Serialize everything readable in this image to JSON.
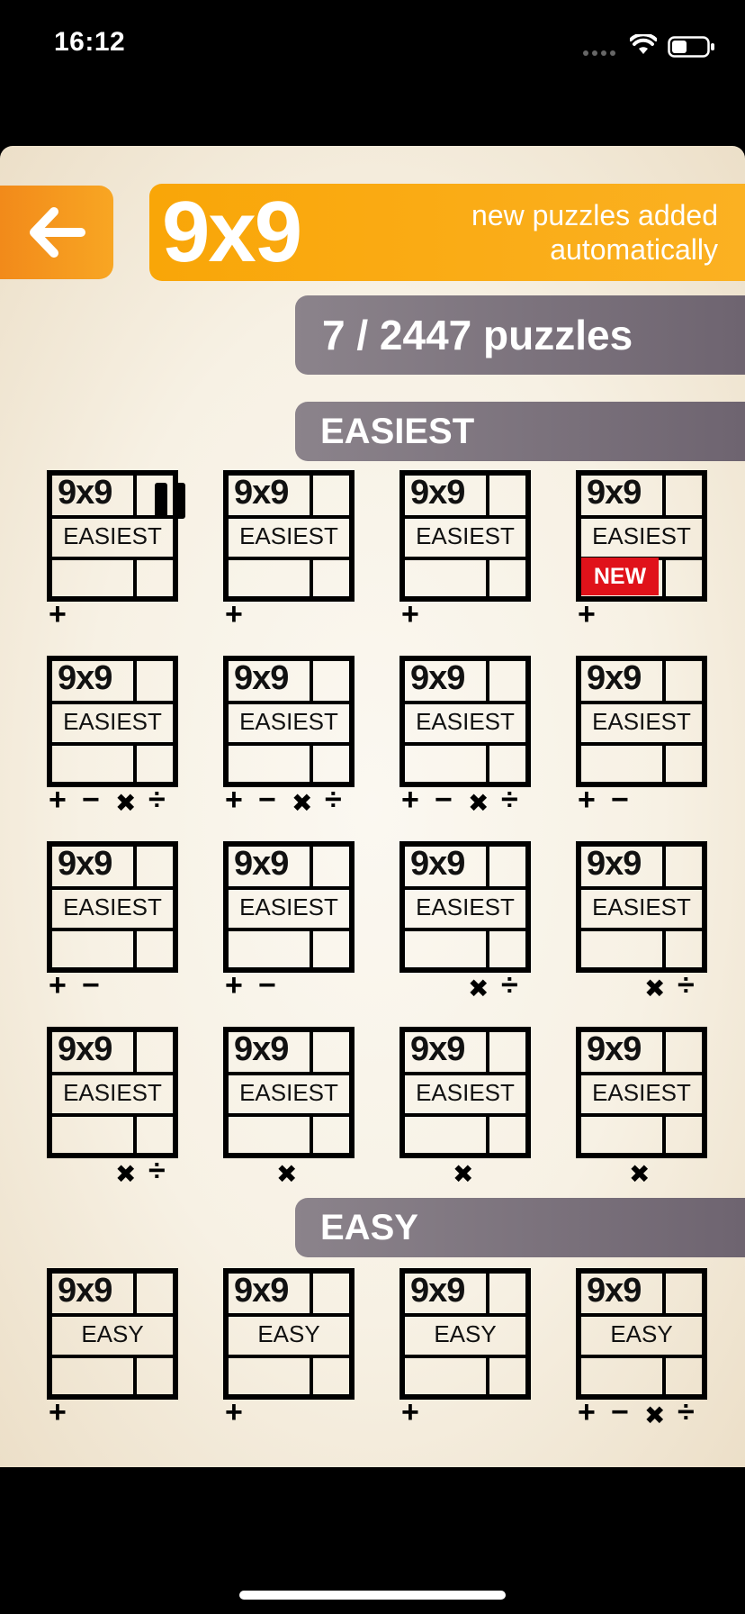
{
  "status": {
    "time": "16:12"
  },
  "header": {
    "title": "9x9",
    "note": "new puzzles added automatically",
    "count": "7 / 2447 puzzles"
  },
  "sections": [
    {
      "label": "EASIEST"
    },
    {
      "label": "EASY"
    }
  ],
  "puzzle_size_label": "9x9",
  "new_badge_label": "NEW",
  "ops_symbols": {
    "plus": "+",
    "minus": "−",
    "times": "✖",
    "divide": "÷"
  },
  "puzzles_easiest": [
    {
      "difficulty": "EASIEST",
      "ops": [
        "+"
      ],
      "align": "left",
      "paused": true,
      "new": false
    },
    {
      "difficulty": "EASIEST",
      "ops": [
        "+"
      ],
      "align": "left",
      "paused": false,
      "new": false
    },
    {
      "difficulty": "EASIEST",
      "ops": [
        "+"
      ],
      "align": "left",
      "paused": false,
      "new": false
    },
    {
      "difficulty": "EASIEST",
      "ops": [
        "+"
      ],
      "align": "left",
      "paused": false,
      "new": true
    },
    {
      "difficulty": "EASIEST",
      "ops": [
        "+",
        "−",
        "✖",
        "÷"
      ],
      "align": "left",
      "paused": false,
      "new": false
    },
    {
      "difficulty": "EASIEST",
      "ops": [
        "+",
        "−",
        "✖",
        "÷"
      ],
      "align": "left",
      "paused": false,
      "new": false
    },
    {
      "difficulty": "EASIEST",
      "ops": [
        "+",
        "−",
        "✖",
        "÷"
      ],
      "align": "left",
      "paused": false,
      "new": false
    },
    {
      "difficulty": "EASIEST",
      "ops": [
        "+",
        "−"
      ],
      "align": "left",
      "paused": false,
      "new": false
    },
    {
      "difficulty": "EASIEST",
      "ops": [
        "+",
        "−"
      ],
      "align": "left",
      "paused": false,
      "new": false
    },
    {
      "difficulty": "EASIEST",
      "ops": [
        "+",
        "−"
      ],
      "align": "left",
      "paused": false,
      "new": false
    },
    {
      "difficulty": "EASIEST",
      "ops": [
        "✖",
        "÷"
      ],
      "align": "right",
      "paused": false,
      "new": false
    },
    {
      "difficulty": "EASIEST",
      "ops": [
        "✖",
        "÷"
      ],
      "align": "right",
      "paused": false,
      "new": false
    },
    {
      "difficulty": "EASIEST",
      "ops": [
        "✖",
        "÷"
      ],
      "align": "right",
      "paused": false,
      "new": false
    },
    {
      "difficulty": "EASIEST",
      "ops": [
        "✖"
      ],
      "align": "center",
      "paused": false,
      "new": false
    },
    {
      "difficulty": "EASIEST",
      "ops": [
        "✖"
      ],
      "align": "center",
      "paused": false,
      "new": false
    },
    {
      "difficulty": "EASIEST",
      "ops": [
        "✖"
      ],
      "align": "center",
      "paused": false,
      "new": false
    }
  ],
  "puzzles_easy": [
    {
      "difficulty": "EASY",
      "ops": [
        "+"
      ],
      "align": "left",
      "paused": false,
      "new": false
    },
    {
      "difficulty": "EASY",
      "ops": [
        "+"
      ],
      "align": "left",
      "paused": false,
      "new": false
    },
    {
      "difficulty": "EASY",
      "ops": [
        "+"
      ],
      "align": "left",
      "paused": false,
      "new": false
    },
    {
      "difficulty": "EASY",
      "ops": [
        "+",
        "−",
        "✖",
        "÷"
      ],
      "align": "left",
      "paused": false,
      "new": false
    }
  ]
}
